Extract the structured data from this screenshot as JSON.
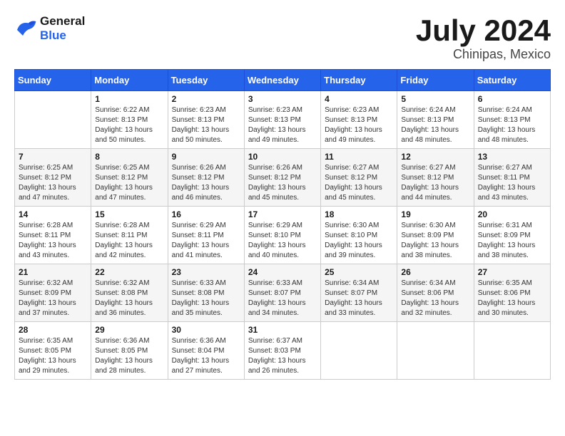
{
  "header": {
    "logo_line1": "General",
    "logo_line2": "Blue",
    "month": "July 2024",
    "location": "Chinipas, Mexico"
  },
  "days_of_week": [
    "Sunday",
    "Monday",
    "Tuesday",
    "Wednesday",
    "Thursday",
    "Friday",
    "Saturday"
  ],
  "weeks": [
    [
      {
        "day": "",
        "info": ""
      },
      {
        "day": "1",
        "info": "Sunrise: 6:22 AM\nSunset: 8:13 PM\nDaylight: 13 hours\nand 50 minutes."
      },
      {
        "day": "2",
        "info": "Sunrise: 6:23 AM\nSunset: 8:13 PM\nDaylight: 13 hours\nand 50 minutes."
      },
      {
        "day": "3",
        "info": "Sunrise: 6:23 AM\nSunset: 8:13 PM\nDaylight: 13 hours\nand 49 minutes."
      },
      {
        "day": "4",
        "info": "Sunrise: 6:23 AM\nSunset: 8:13 PM\nDaylight: 13 hours\nand 49 minutes."
      },
      {
        "day": "5",
        "info": "Sunrise: 6:24 AM\nSunset: 8:13 PM\nDaylight: 13 hours\nand 48 minutes."
      },
      {
        "day": "6",
        "info": "Sunrise: 6:24 AM\nSunset: 8:13 PM\nDaylight: 13 hours\nand 48 minutes."
      }
    ],
    [
      {
        "day": "7",
        "info": "Sunrise: 6:25 AM\nSunset: 8:12 PM\nDaylight: 13 hours\nand 47 minutes."
      },
      {
        "day": "8",
        "info": "Sunrise: 6:25 AM\nSunset: 8:12 PM\nDaylight: 13 hours\nand 47 minutes."
      },
      {
        "day": "9",
        "info": "Sunrise: 6:26 AM\nSunset: 8:12 PM\nDaylight: 13 hours\nand 46 minutes."
      },
      {
        "day": "10",
        "info": "Sunrise: 6:26 AM\nSunset: 8:12 PM\nDaylight: 13 hours\nand 45 minutes."
      },
      {
        "day": "11",
        "info": "Sunrise: 6:27 AM\nSunset: 8:12 PM\nDaylight: 13 hours\nand 45 minutes."
      },
      {
        "day": "12",
        "info": "Sunrise: 6:27 AM\nSunset: 8:12 PM\nDaylight: 13 hours\nand 44 minutes."
      },
      {
        "day": "13",
        "info": "Sunrise: 6:27 AM\nSunset: 8:11 PM\nDaylight: 13 hours\nand 43 minutes."
      }
    ],
    [
      {
        "day": "14",
        "info": "Sunrise: 6:28 AM\nSunset: 8:11 PM\nDaylight: 13 hours\nand 43 minutes."
      },
      {
        "day": "15",
        "info": "Sunrise: 6:28 AM\nSunset: 8:11 PM\nDaylight: 13 hours\nand 42 minutes."
      },
      {
        "day": "16",
        "info": "Sunrise: 6:29 AM\nSunset: 8:11 PM\nDaylight: 13 hours\nand 41 minutes."
      },
      {
        "day": "17",
        "info": "Sunrise: 6:29 AM\nSunset: 8:10 PM\nDaylight: 13 hours\nand 40 minutes."
      },
      {
        "day": "18",
        "info": "Sunrise: 6:30 AM\nSunset: 8:10 PM\nDaylight: 13 hours\nand 39 minutes."
      },
      {
        "day": "19",
        "info": "Sunrise: 6:30 AM\nSunset: 8:09 PM\nDaylight: 13 hours\nand 38 minutes."
      },
      {
        "day": "20",
        "info": "Sunrise: 6:31 AM\nSunset: 8:09 PM\nDaylight: 13 hours\nand 38 minutes."
      }
    ],
    [
      {
        "day": "21",
        "info": "Sunrise: 6:32 AM\nSunset: 8:09 PM\nDaylight: 13 hours\nand 37 minutes."
      },
      {
        "day": "22",
        "info": "Sunrise: 6:32 AM\nSunset: 8:08 PM\nDaylight: 13 hours\nand 36 minutes."
      },
      {
        "day": "23",
        "info": "Sunrise: 6:33 AM\nSunset: 8:08 PM\nDaylight: 13 hours\nand 35 minutes."
      },
      {
        "day": "24",
        "info": "Sunrise: 6:33 AM\nSunset: 8:07 PM\nDaylight: 13 hours\nand 34 minutes."
      },
      {
        "day": "25",
        "info": "Sunrise: 6:34 AM\nSunset: 8:07 PM\nDaylight: 13 hours\nand 33 minutes."
      },
      {
        "day": "26",
        "info": "Sunrise: 6:34 AM\nSunset: 8:06 PM\nDaylight: 13 hours\nand 32 minutes."
      },
      {
        "day": "27",
        "info": "Sunrise: 6:35 AM\nSunset: 8:06 PM\nDaylight: 13 hours\nand 30 minutes."
      }
    ],
    [
      {
        "day": "28",
        "info": "Sunrise: 6:35 AM\nSunset: 8:05 PM\nDaylight: 13 hours\nand 29 minutes."
      },
      {
        "day": "29",
        "info": "Sunrise: 6:36 AM\nSunset: 8:05 PM\nDaylight: 13 hours\nand 28 minutes."
      },
      {
        "day": "30",
        "info": "Sunrise: 6:36 AM\nSunset: 8:04 PM\nDaylight: 13 hours\nand 27 minutes."
      },
      {
        "day": "31",
        "info": "Sunrise: 6:37 AM\nSunset: 8:03 PM\nDaylight: 13 hours\nand 26 minutes."
      },
      {
        "day": "",
        "info": ""
      },
      {
        "day": "",
        "info": ""
      },
      {
        "day": "",
        "info": ""
      }
    ]
  ]
}
